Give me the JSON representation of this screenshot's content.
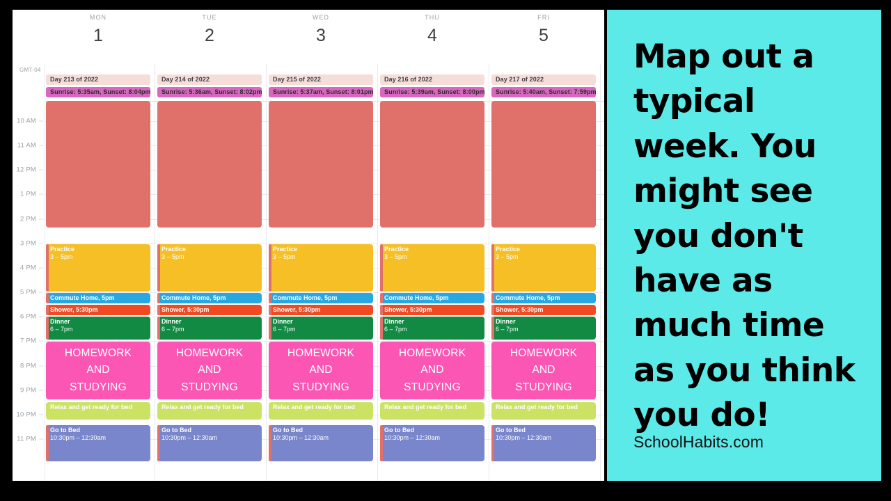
{
  "colors": {
    "panel_bg": "#5ceae9",
    "page_bg": "#000000",
    "calendar_bg": "#ffffff",
    "salmon": "#e0716a",
    "amber": "#f7bf26",
    "blue": "#28a8e0",
    "orange_red": "#f04a22",
    "green": "#128a43",
    "pink": "#fb56b4",
    "lime": "#cbe265",
    "periwinkle": "#7986cb",
    "allday_pale": "#f6ddd9",
    "sunrise_magenta": "#d967c2",
    "gridline": "#e8eaed",
    "muted_text": "#9aa0a6"
  },
  "calendar": {
    "timezone_label": "GMT-04",
    "hours": [
      "10 AM",
      "11 AM",
      "12 PM",
      "1 PM",
      "2 PM",
      "3 PM",
      "4 PM",
      "5 PM",
      "6 PM",
      "7 PM",
      "8 PM",
      "9 PM",
      "10 PM",
      "11 PM"
    ],
    "days": [
      {
        "dow": "MON",
        "date": "1",
        "day_of_year": "Day 213 of 2022",
        "sun": "Sunrise: 5:35am, Sunset: 8:04pm",
        "events": [
          {
            "title": "",
            "time": "",
            "kind": "school-block"
          },
          {
            "title": "Practice",
            "time": "3 – 5pm",
            "kind": "practice"
          },
          {
            "title": "Commute Home, 5pm",
            "time": "",
            "kind": "commute"
          },
          {
            "title": "Shower, 5:30pm",
            "time": "",
            "kind": "shower"
          },
          {
            "title": "Dinner",
            "time": "6 – 7pm",
            "kind": "dinner"
          },
          {
            "title": "HOMEWORK AND STUDYING",
            "time": "",
            "kind": "homework"
          },
          {
            "title": "Relax and get ready for bed",
            "time": "",
            "kind": "relax"
          },
          {
            "title": "Go to Bed",
            "time": "10:30pm – 12:30am",
            "kind": "bed"
          }
        ]
      },
      {
        "dow": "TUE",
        "date": "2",
        "day_of_year": "Day 214 of 2022",
        "sun": "Sunrise: 5:36am, Sunset: 8:02pm",
        "events": [
          {
            "title": "",
            "time": "",
            "kind": "school-block"
          },
          {
            "title": "Practice",
            "time": "3 – 5pm",
            "kind": "practice"
          },
          {
            "title": "Commute Home, 5pm",
            "time": "",
            "kind": "commute"
          },
          {
            "title": "Shower, 5:30pm",
            "time": "",
            "kind": "shower"
          },
          {
            "title": "Dinner",
            "time": "6 – 7pm",
            "kind": "dinner"
          },
          {
            "title": "HOMEWORK AND STUDYING",
            "time": "",
            "kind": "homework"
          },
          {
            "title": "Relax and get ready for bed",
            "time": "",
            "kind": "relax"
          },
          {
            "title": "Go to Bed",
            "time": "10:30pm – 12:30am",
            "kind": "bed"
          }
        ]
      },
      {
        "dow": "WED",
        "date": "3",
        "day_of_year": "Day 215 of 2022",
        "sun": "Sunrise: 5:37am, Sunset: 8:01pm",
        "events": [
          {
            "title": "",
            "time": "",
            "kind": "school-block"
          },
          {
            "title": "Practice",
            "time": "3 – 5pm",
            "kind": "practice"
          },
          {
            "title": "Commute Home, 5pm",
            "time": "",
            "kind": "commute"
          },
          {
            "title": "Shower, 5:30pm",
            "time": "",
            "kind": "shower"
          },
          {
            "title": "Dinner",
            "time": "6 – 7pm",
            "kind": "dinner"
          },
          {
            "title": "HOMEWORK AND STUDYING",
            "time": "",
            "kind": "homework"
          },
          {
            "title": "Relax and get ready for bed",
            "time": "",
            "kind": "relax"
          },
          {
            "title": "Go to Bed",
            "time": "10:30pm – 12:30am",
            "kind": "bed"
          }
        ]
      },
      {
        "dow": "THU",
        "date": "4",
        "day_of_year": "Day 216 of 2022",
        "sun": "Sunrise: 5:39am, Sunset: 8:00pm",
        "events": [
          {
            "title": "",
            "time": "",
            "kind": "school-block"
          },
          {
            "title": "Practice",
            "time": "3 – 5pm",
            "kind": "practice"
          },
          {
            "title": "Commute Home, 5pm",
            "time": "",
            "kind": "commute"
          },
          {
            "title": "Shower, 5:30pm",
            "time": "",
            "kind": "shower"
          },
          {
            "title": "Dinner",
            "time": "6 – 7pm",
            "kind": "dinner"
          },
          {
            "title": "HOMEWORK AND STUDYING",
            "time": "",
            "kind": "homework"
          },
          {
            "title": "Relax and get ready for bed",
            "time": "",
            "kind": "relax"
          },
          {
            "title": "Go to Bed",
            "time": "10:30pm – 12:30am",
            "kind": "bed"
          }
        ]
      },
      {
        "dow": "FRI",
        "date": "5",
        "day_of_year": "Day 217 of 2022",
        "sun": "Sunrise: 5:40am, Sunset: 7:59pm",
        "events": [
          {
            "title": "",
            "time": "",
            "kind": "school-block"
          },
          {
            "title": "Practice",
            "time": "3 – 5pm",
            "kind": "practice"
          },
          {
            "title": "Commute Home, 5pm",
            "time": "",
            "kind": "commute"
          },
          {
            "title": "Shower, 5:30pm",
            "time": "",
            "kind": "shower"
          },
          {
            "title": "Dinner",
            "time": "6 – 7pm",
            "kind": "dinner"
          },
          {
            "title": "HOMEWORK AND STUDYING",
            "time": "",
            "kind": "homework"
          },
          {
            "title": "Relax and get ready for bed",
            "time": "",
            "kind": "relax"
          },
          {
            "title": "Go to Bed",
            "time": "10:30pm – 12:30am",
            "kind": "bed"
          }
        ]
      }
    ]
  },
  "promo": {
    "headline": "Map out a typical week. You might see you don't have as much time as you think you do!",
    "site": "SchoolHabits.com"
  }
}
